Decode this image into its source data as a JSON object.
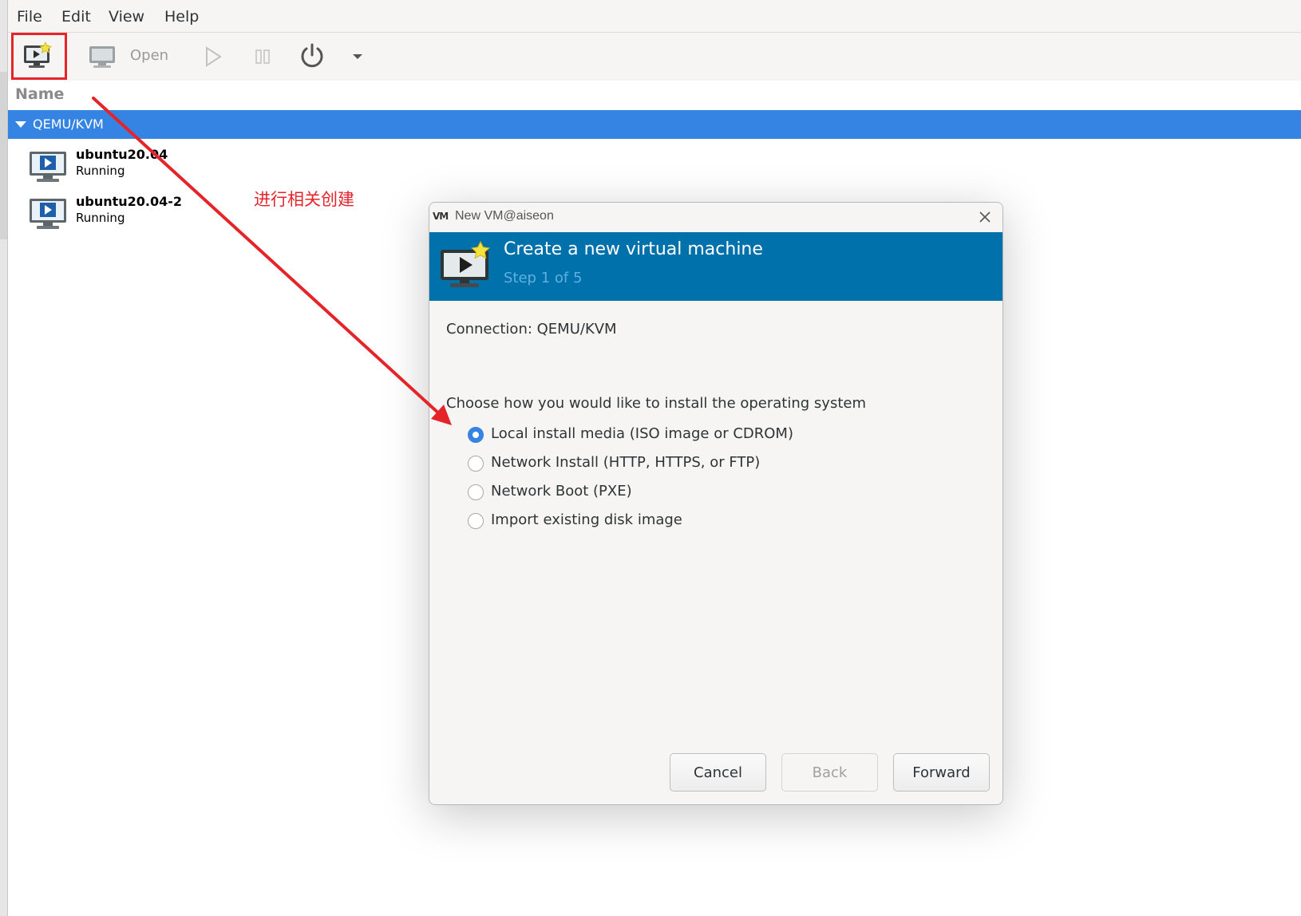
{
  "menu": {
    "file": "File",
    "edit": "Edit",
    "view": "View",
    "help": "Help"
  },
  "toolbar": {
    "open_label": "Open"
  },
  "list": {
    "column_name": "Name",
    "connection": "QEMU/KVM",
    "vms": [
      {
        "name": "ubuntu20.04",
        "state": "Running"
      },
      {
        "name": "ubuntu20.04-2",
        "state": "Running"
      }
    ]
  },
  "annotation": {
    "text": "进行相关创建",
    "color": "#e5242a"
  },
  "dialog": {
    "title": "New VM@aiseon",
    "heading": "Create a new virtual machine",
    "step": "Step 1 of 5",
    "connection": "Connection:  QEMU/KVM",
    "prompt": "Choose how you would like to install the operating system",
    "options": [
      {
        "label": "Local install media (ISO image or CDROM)",
        "selected": true
      },
      {
        "label": "Network Install (HTTP, HTTPS, or FTP)",
        "selected": false
      },
      {
        "label": "Network Boot (PXE)",
        "selected": false
      },
      {
        "label": "Import existing disk image",
        "selected": false
      }
    ],
    "buttons": {
      "cancel": "Cancel",
      "back": "Back",
      "forward": "Forward"
    }
  },
  "colors": {
    "selection_blue": "#3584e4",
    "banner_blue": "#0071ab",
    "highlight_red": "#e5242a"
  }
}
